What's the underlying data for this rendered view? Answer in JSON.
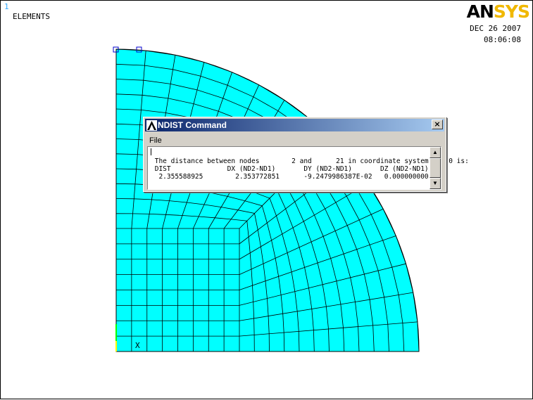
{
  "graphics": {
    "window_number": "1",
    "plot_label": "ELEMENTS",
    "date": "DEC 26 2007",
    "time": "08:06:08",
    "logo_black": "AN",
    "logo_yellow": "SYS",
    "triad_x": "X",
    "mesh_fill_color": "#00ffff",
    "mesh_line_color": "#000000",
    "node_marker_color": "#0000cc"
  },
  "dialog": {
    "title": "NDIST   Command",
    "close_glyph": "×",
    "menu": [
      "File"
    ],
    "output_lines": [
      " The distance between nodes        2 and      21 in coordinate system     0 is:",
      " DIST              DX (ND2-ND1)       DY (ND2-ND1)       DZ (ND2-ND1)",
      "  2.355588925        2.353772851      -9.2479986387E-02   0.000000000"
    ]
  }
}
